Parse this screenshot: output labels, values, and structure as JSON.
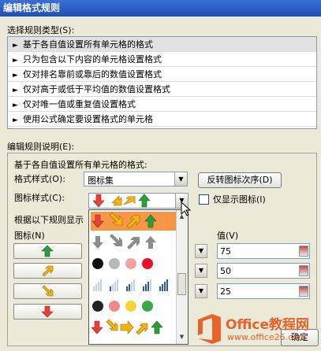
{
  "window": {
    "title": "编辑格式规则"
  },
  "rule_type": {
    "label": "选择规则类型(S):",
    "items": [
      "基于各自值设置所有单元格的格式",
      "只为包含以下内容的单元格设置格式",
      "仅对排名靠前或靠后的数值设置格式",
      "仅对高于或低于平均值的数值设置格式",
      "仅对唯一值或重复值设置格式",
      "使用公式确定要设置格式的单元格"
    ],
    "selected_index": 0,
    "bullet": "►"
  },
  "edit": {
    "label": "编辑规则说明(E):",
    "description": "基于各自值设置所有单元格的格式:",
    "format_style_label": "格式样式(O):",
    "format_style_value": "图标集",
    "reverse_button": "反转图标次序(D)",
    "icon_style_label": "图标样式(C):",
    "show_icon_only_label": "仅显示图标(I)",
    "show_icon_only_checked": false,
    "rules_text": "根据以下规则显示",
    "icon_header": "图标(N)",
    "value_header": "值(V)"
  },
  "icon_rows": [
    {
      "icon": "green-up-arrow-icon",
      "value": "75"
    },
    {
      "icon": "yellow-up-right-arrow-icon",
      "value": "50"
    },
    {
      "icon": "yellow-down-right-arrow-icon",
      "value": "25"
    },
    {
      "icon": "red-down-arrow-icon",
      "value": ""
    }
  ],
  "popup": {
    "rows": [
      "red-yellow-green-arrows-icon-set",
      "gray-arrows-icon-set",
      "traffic-lights-circles-icon-set",
      "signal-bars-icon-set",
      "black-red-yellow-green-circles-icon-set",
      "five-arrows-icon-set"
    ],
    "highlighted_index": 0
  },
  "buttons": {
    "ok": "确定"
  },
  "watermark": {
    "brand": "Office教程网",
    "url": "www.office26.com"
  },
  "colors": {
    "title_bar": "#2a5cc8",
    "highlight": "#f79646",
    "green": "#2e9e3c",
    "yellow": "#f5b316",
    "red": "#e8403c"
  }
}
